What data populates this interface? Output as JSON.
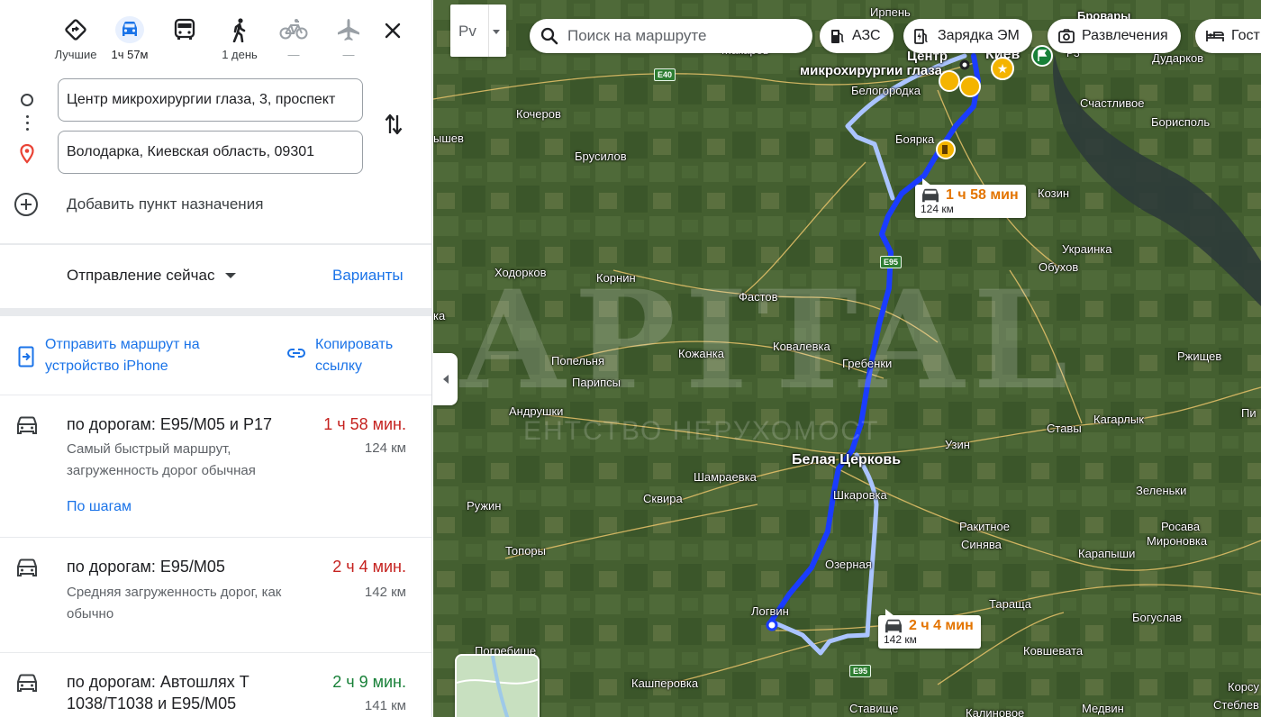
{
  "modes": [
    {
      "name": "best",
      "label": "Лучшие"
    },
    {
      "name": "car",
      "label": "1ч 57м"
    },
    {
      "name": "transit",
      "label": ""
    },
    {
      "name": "walk",
      "label": "1 день"
    },
    {
      "name": "bike",
      "label": "—"
    },
    {
      "name": "flight",
      "label": "—"
    }
  ],
  "waypoints": {
    "origin": "Центр микрохирургии глаза, 3, проспект",
    "destination": "Володарка, Киевская область, 09301",
    "add_label": "Добавить пункт назначения"
  },
  "depart": {
    "label": "Отправление сейчас",
    "options_label": "Варианты"
  },
  "share": {
    "send_label": "Отправить маршрут на устройство iPhone",
    "copy_label": "Копировать ссылку"
  },
  "routes": [
    {
      "title": "по дорогам: E95/M05 и P17",
      "time": "1 ч 58 мин.",
      "time_color": "#c5221f",
      "distance": "124 км",
      "desc": "Самый быстрый маршрут, загруженность дорог обычная",
      "steps": "По шагам"
    },
    {
      "title": "по дорогам: E95/M05",
      "time": "2 ч 4 мин.",
      "time_color": "#c5221f",
      "distance": "142 км",
      "desc": "Средняя загруженность дорог, как обычно"
    },
    {
      "title": "по дорогам: Автошлях T 1038/T1038 и E95/M05",
      "time": "2 ч 9 мин.",
      "time_color": "#188038",
      "distance": "141 км"
    }
  ],
  "map": {
    "layer_label": "Рv",
    "search_placeholder": "Поиск на маршруте",
    "chips": [
      "АЗС",
      "Зарядка ЭМ",
      "Развлечения",
      "Гост"
    ],
    "eta_primary": {
      "time": "1 ч 58 мин",
      "distance": "124 км"
    },
    "eta_alt": {
      "time": "2 ч 4 мин",
      "distance": "142 км"
    },
    "roads": [
      "E40",
      "E95",
      "E95"
    ],
    "watermark": "APITAL",
    "watermark_sub": "ЕНТСТВО НЕРУХОМОСТ",
    "places": [
      {
        "n": "Ирпень"
      },
      {
        "n": "Бровары"
      },
      {
        "n": "Макаров"
      },
      {
        "n": "Центр"
      },
      {
        "n": "микрохирургии глаза"
      },
      {
        "n": "Киев"
      },
      {
        "n": "Дударков"
      },
      {
        "n": "Белогородка"
      },
      {
        "n": "Кочеров"
      },
      {
        "n": "Счастливое"
      },
      {
        "n": "Борисполь"
      },
      {
        "n": "ышев"
      },
      {
        "n": "Боярка"
      },
      {
        "n": "Брусилов"
      },
      {
        "n": "Козин"
      },
      {
        "n": "Украинка"
      },
      {
        "n": "Обухов"
      },
      {
        "n": "Ходорков"
      },
      {
        "n": "Корнин"
      },
      {
        "n": "Фастов"
      },
      {
        "n": "ка"
      },
      {
        "n": "Кожанка"
      },
      {
        "n": "Ковалевка"
      },
      {
        "n": "Попельня"
      },
      {
        "n": "Гребенки"
      },
      {
        "n": "Ржищев"
      },
      {
        "n": "Парипсы"
      },
      {
        "n": "Андрушки"
      },
      {
        "n": "Кагарлык"
      },
      {
        "n": "Пи"
      },
      {
        "n": "Ставы"
      },
      {
        "n": "Узин"
      },
      {
        "n": "Белая Церковь"
      },
      {
        "n": "Шамраевка"
      },
      {
        "n": "Сквира"
      },
      {
        "n": "Шкаровка"
      },
      {
        "n": "Зеленьки"
      },
      {
        "n": "Ружин"
      },
      {
        "n": "Ракитное"
      },
      {
        "n": "Синява"
      },
      {
        "n": "Росава"
      },
      {
        "n": "Мироновка"
      },
      {
        "n": "Топоры"
      },
      {
        "n": "Карапыши"
      },
      {
        "n": "Озерная"
      },
      {
        "n": "Логвин"
      },
      {
        "n": "Тараща"
      },
      {
        "n": "Богуслав"
      },
      {
        "n": "Погребище"
      },
      {
        "n": "Ковшевата"
      },
      {
        "n": "Кашперовка"
      },
      {
        "n": "Ставище"
      },
      {
        "n": "Калиновое"
      },
      {
        "n": "Медвин"
      },
      {
        "n": "Корсу"
      },
      {
        "n": "Стеблев"
      },
      {
        "n": "Р3"
      }
    ]
  }
}
